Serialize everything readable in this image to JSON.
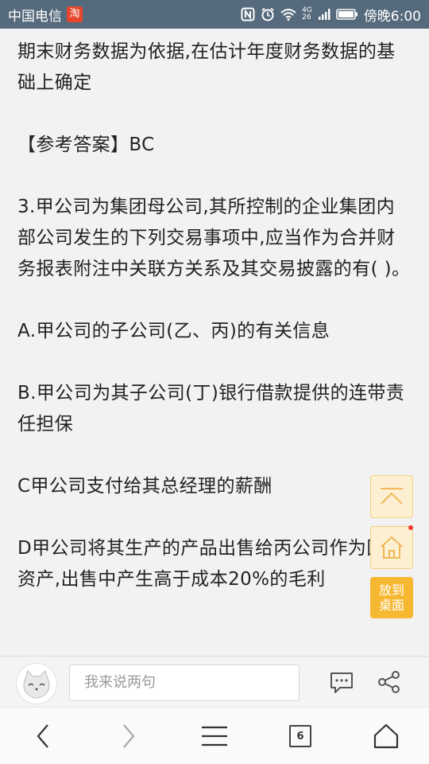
{
  "status_bar": {
    "carrier": "中国电信",
    "app_badge": "淘",
    "network_top": "4G",
    "network_bottom": "26",
    "time": "傍晚6:00"
  },
  "article": {
    "paragraphs": [
      "期末财务数据为依据,在估计年度财务数据的基础上确定",
      "【参考答案】BC",
      "3.甲公司为集团母公司,其所控制的企业集团内部公司发生的下列交易事项中,应当作为合并财务报表附注中关联方关系及其交易披露的有( )。",
      "A.甲公司的子公司(乙、丙)的有关信息",
      "B.甲公司为其子公司(丁)银行借款提供的连带责任担保",
      "C甲公司支付给其总经理的薪酬",
      "D甲公司将其生产的产品出售给丙公司作为固定资产,出售中产生高于成本20%的毛利"
    ]
  },
  "floating": {
    "to_desktop_line1": "放到",
    "to_desktop_line2": "桌面"
  },
  "comment_bar": {
    "placeholder": "我来说两句"
  },
  "bottom_nav": {
    "tab_count": "6"
  },
  "colors": {
    "status_bar": "#556a7c",
    "fab_bg": "#fdf0d2",
    "fab_border": "#f3cf7b",
    "desk_button": "#f6b731"
  }
}
